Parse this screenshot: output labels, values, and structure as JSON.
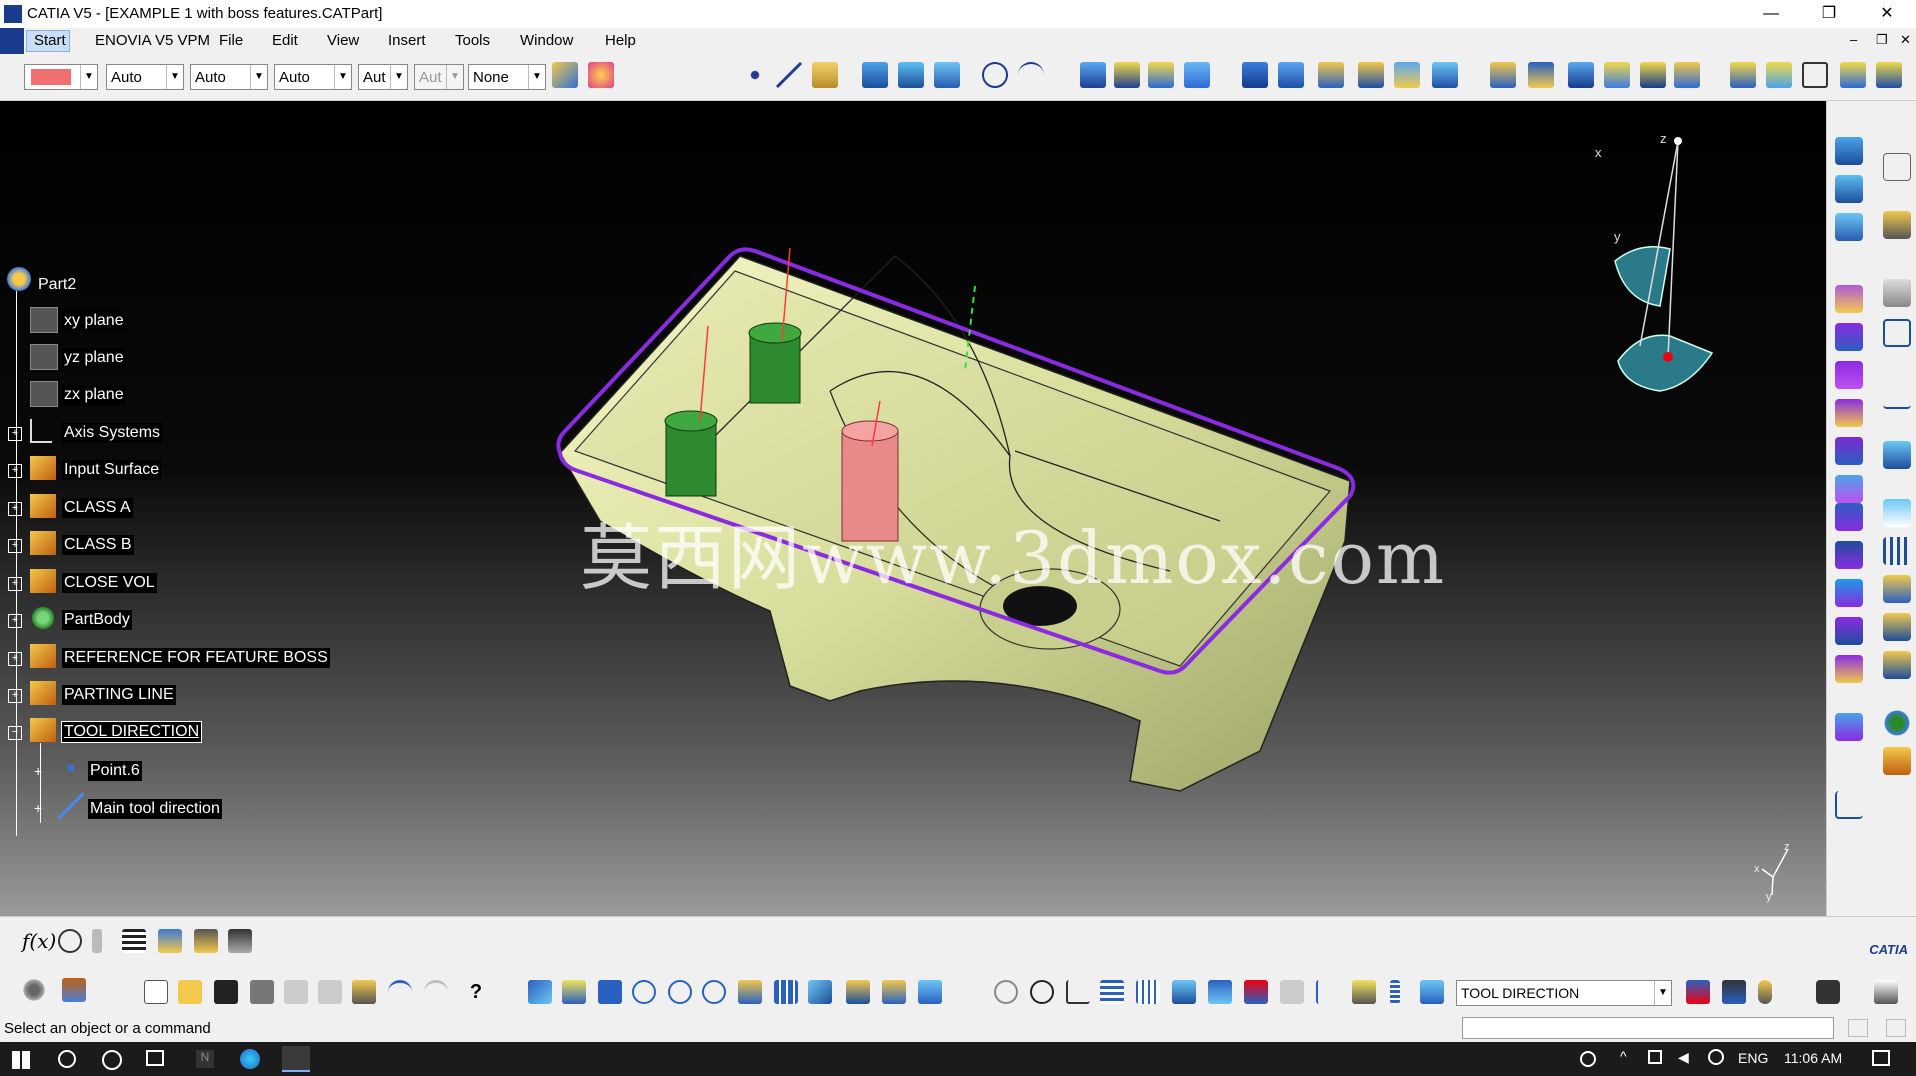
{
  "window": {
    "title": "CATIA V5 - [EXAMPLE 1 with boss features.CATPart]",
    "controls": {
      "minimize": "—",
      "restore": "❐",
      "close": "✕"
    },
    "doc_controls": {
      "minimize": "–",
      "restore": "❐",
      "close": "✕"
    }
  },
  "menu": [
    "Start",
    "ENOVIA V5 VPM",
    "File",
    "Edit",
    "View",
    "Insert",
    "Tools",
    "Window",
    "Help"
  ],
  "graphic_props": {
    "color": "#f07070",
    "linetype": "Auto",
    "thickness": "Auto",
    "pattern": "Auto",
    "layer_short": "Aut",
    "disabled_short": "Aut",
    "none": "None"
  },
  "tree": {
    "root": "Part2",
    "items": [
      {
        "label": "xy plane",
        "icon": "plane-icon"
      },
      {
        "label": "yz plane",
        "icon": "plane-icon"
      },
      {
        "label": "zx plane",
        "icon": "plane-icon"
      },
      {
        "label": "Axis Systems",
        "icon": "axis-system-icon"
      },
      {
        "label": "Input Surface",
        "icon": "geometrical-set-icon"
      },
      {
        "label": "CLASS A",
        "icon": "geometrical-set-icon"
      },
      {
        "label": "CLASS B",
        "icon": "geometrical-set-icon"
      },
      {
        "label": "CLOSE VOL",
        "icon": "geometrical-set-icon"
      },
      {
        "label": "PartBody",
        "icon": "partbody-icon"
      },
      {
        "label": "REFERENCE FOR FEATURE BOSS",
        "icon": "geometrical-set-icon"
      },
      {
        "label": "PARTING LINE",
        "icon": "geometrical-set-icon"
      },
      {
        "label": "TOOL DIRECTION",
        "icon": "geometrical-set-icon"
      }
    ],
    "children": [
      {
        "label": "Point.6",
        "icon": "point-icon"
      },
      {
        "label": "Main tool direction",
        "icon": "line-icon"
      }
    ]
  },
  "compass": {
    "x": "x",
    "y": "y",
    "z": "z"
  },
  "watermark": "莫西网www.3dmox.com",
  "current_set": "TOOL DIRECTION",
  "status": "Select an object or a command",
  "taskbar": {
    "lang": "ENG",
    "time": "11:06 AM"
  },
  "brand": "CATIA"
}
